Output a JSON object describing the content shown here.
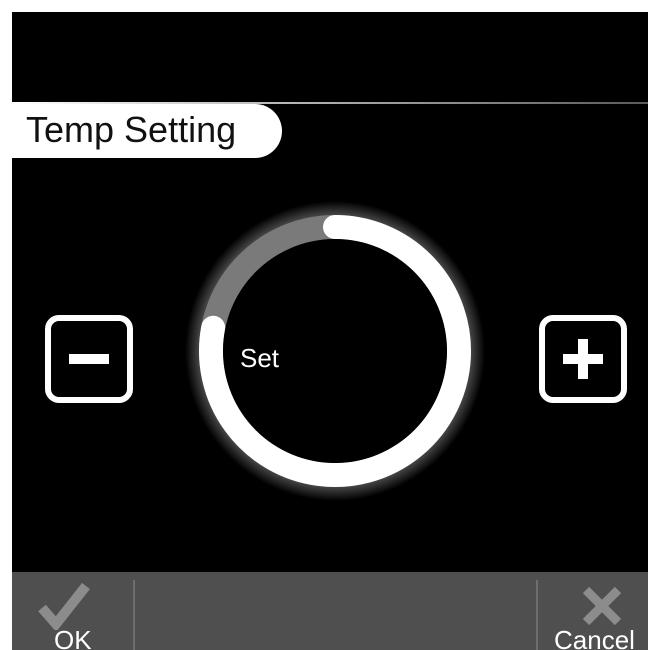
{
  "header": {
    "title": "Temp Setting"
  },
  "dial": {
    "label": "Set",
    "level": 0.78,
    "colors": {
      "active": "#ffffff",
      "inactive": "#7a7a7a",
      "glow": "#ffffff"
    }
  },
  "controls": {
    "decrease_icon": "minus-icon",
    "increase_icon": "plus-icon"
  },
  "footer": {
    "ok_label": "OK",
    "ok_icon": "checkmark-icon",
    "cancel_label": "Cancel",
    "cancel_icon": "x-icon"
  },
  "colors": {
    "background": "#000000",
    "footer": "#4f4f4f",
    "foreground": "#ffffff"
  }
}
